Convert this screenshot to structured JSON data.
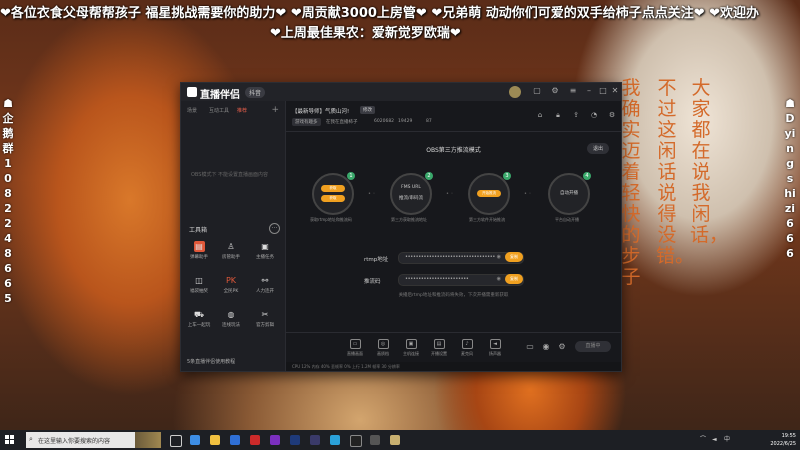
{
  "stream_overlay": {
    "banner_line1": "❤各位衣食父母帮帮孩子 福星挑战需要你的助力❤ ❤周贡献3000上房管❤ ❤兄弟萌 动动你们可爱的双手给柿子点点关注❤ ❤欢迎办",
    "banner_line2": "❤上周最佳果农：爱新觉罗欧瑞❤",
    "left_vertical": "☗企鹅群1082248665",
    "right_vertical": "☗Dyingshizi666",
    "poem_col1": "大家都在说我闲话，",
    "poem_col2": "不过这闲话说得没错。",
    "poem_col3": "我确实迈着轻快的步子"
  },
  "window": {
    "app_name": "直播伴侣",
    "version": "抖音",
    "left_panel": {
      "tabs": [
        "场景",
        "互动工具",
        "推荐",
        "观众"
      ],
      "obs_hint": "OBS模式下 不能设置直播画面内容",
      "tools_title": "工具箱",
      "tools": [
        {
          "label": "弹幕助手",
          "icon": "danmaku-icon",
          "color": "#e0583a"
        },
        {
          "label": "房管助手",
          "icon": "manager-icon",
          "color": "#3a3b42"
        },
        {
          "label": "主播任务",
          "icon": "task-icon",
          "color": "#3a3b42"
        },
        {
          "label": "福袋抽奖",
          "icon": "lucky-bag-icon",
          "color": "#3a3b42"
        },
        {
          "label": "全民PK",
          "icon": "pk-icon",
          "color": "#3a3b42"
        },
        {
          "label": "人力连开",
          "icon": "link-icon",
          "color": "#3a3b42"
        },
        {
          "label": "上车一起玩",
          "icon": "car-icon",
          "color": "#3a3b42"
        },
        {
          "label": "连线玩法",
          "icon": "game-icon",
          "color": "#3a3b42"
        },
        {
          "label": "官方剪辑",
          "icon": "scissors-icon",
          "color": "#3a3b42"
        }
      ],
      "bottom_text": "5条直播伴侣使用教程"
    },
    "main": {
      "room_title": "【最新导师】气质山河!",
      "edit_label": "修改",
      "category_tag": "游戏有趣多",
      "anchor_name": "在我在直播柿子",
      "anchor_id": "6020682",
      "fans": "19429",
      "online": "87",
      "mode_title": "OBS第三方推流模式",
      "exit_label": "退出",
      "steps": [
        {
          "num": "1",
          "buttons": [
            "获取",
            "获取"
          ],
          "desc": "获取rtmp地址和推流码"
        },
        {
          "num": "2",
          "text_top": "FMS URL",
          "text_bottom": "推流/串码流",
          "desc": "第三方获取推流地址"
        },
        {
          "num": "3",
          "button": "开始推流",
          "desc": "第三方软件开始推流"
        },
        {
          "num": "4",
          "text": "自动开播",
          "desc": "平台自动开播"
        }
      ],
      "rtmp_label": "rtmp地址",
      "rtmp_value": "••••••••••••••••••••••••••••••••••",
      "key_label": "推流码",
      "key_value": "••••••••••••••••••••••••",
      "copy_label": "复制",
      "hint_text": "关播后rtmp地址和推流码将失效，下次开播需重新获取",
      "toolbar": [
        {
          "label": "直播画面",
          "icon": "screen-icon"
        },
        {
          "label": "画质档",
          "icon": "quality-icon"
        },
        {
          "label": "主机连接",
          "icon": "host-icon"
        },
        {
          "label": "开播设置",
          "icon": "settings-icon"
        },
        {
          "label": "麦克风",
          "icon": "mic-icon"
        },
        {
          "label": "扬声器",
          "icon": "speaker-icon"
        }
      ],
      "start_label": "直播中",
      "status_text": "CPU 12%   内存 40%   丢帧率 0%   上行 1.2M   帧率 30   分辨率"
    }
  },
  "taskbar": {
    "search_placeholder": "在这里输入你要搜索的内容",
    "time": "19:55",
    "date": "2022/6/25"
  }
}
